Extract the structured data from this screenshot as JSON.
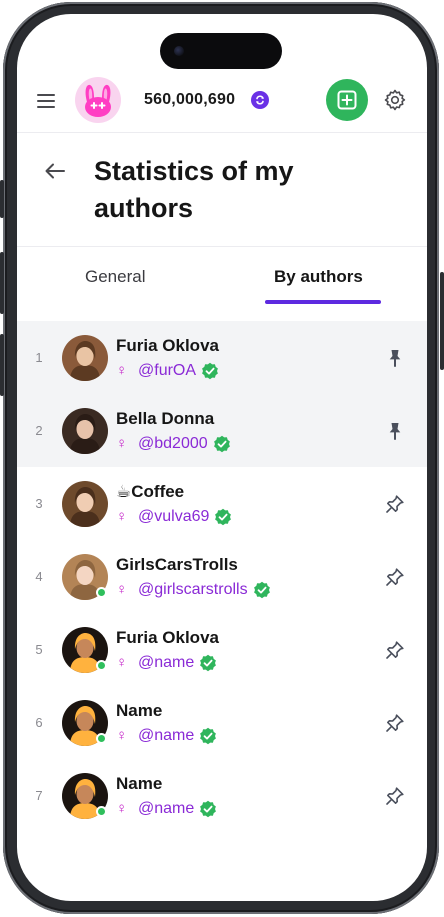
{
  "header": {
    "balance": "560,000,690",
    "icons": {
      "menu": "menu-icon",
      "logo": "bunny-logo-icon",
      "coin": "coin-icon",
      "add": "plus-square-icon",
      "settings": "gear-icon"
    }
  },
  "page": {
    "title": "Statistics of my authors",
    "back_icon": "arrow-left-icon"
  },
  "tabs": [
    {
      "label": "General",
      "active": false
    },
    {
      "label": "By authors",
      "active": true
    }
  ],
  "authors": [
    {
      "rank": "1",
      "name": "Furia Oklova",
      "handle": "@furOA",
      "gender": "♀",
      "verified": true,
      "pinned": true,
      "online": false
    },
    {
      "rank": "2",
      "name": "Bella Donna",
      "handle": "@bd2000",
      "gender": "♀",
      "verified": true,
      "pinned": true,
      "online": false
    },
    {
      "rank": "3",
      "name": "☕Coffee",
      "handle": "@vulva69",
      "gender": "♀",
      "verified": true,
      "pinned": false,
      "online": false
    },
    {
      "rank": "4",
      "name": "GirlsCarsTrolls",
      "handle": "@girlscarstrolls",
      "gender": "♀",
      "verified": true,
      "pinned": false,
      "online": true
    },
    {
      "rank": "5",
      "name": "Furia Oklova",
      "handle": "@name",
      "gender": "♀",
      "verified": true,
      "pinned": false,
      "online": true
    },
    {
      "rank": "6",
      "name": "Name",
      "handle": "@name",
      "gender": "♀",
      "verified": true,
      "pinned": false,
      "online": true
    },
    {
      "rank": "7",
      "name": "Name",
      "handle": "@name",
      "gender": "♀",
      "verified": true,
      "pinned": false,
      "online": true
    }
  ],
  "colors": {
    "accent": "#5d2ae0",
    "add_button": "#2fb55c",
    "verified": "#2fb55c",
    "online": "#2fbf5c",
    "gender": "#c424c9",
    "handle": "#8a2ad6",
    "pinned_row": "#f3f4f6"
  }
}
